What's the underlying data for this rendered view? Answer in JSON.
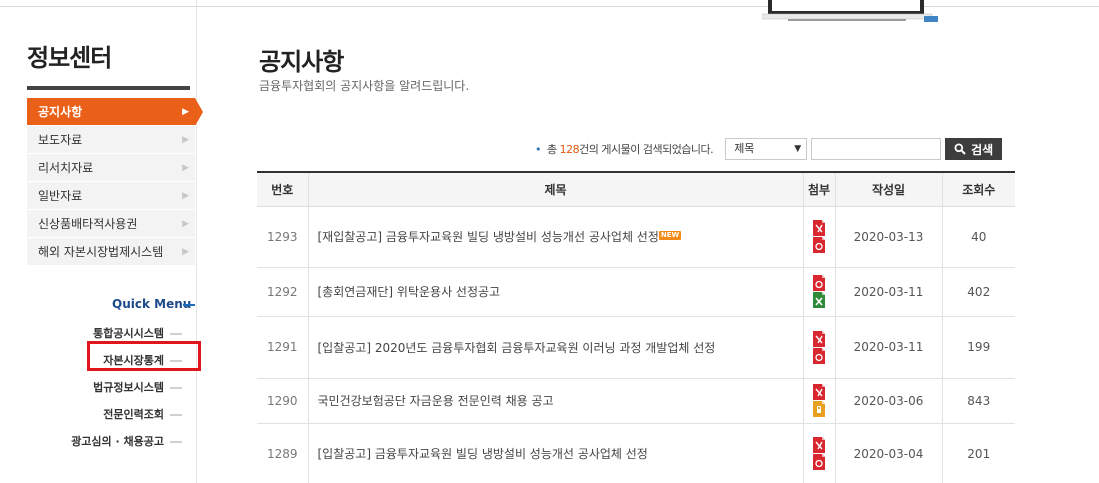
{
  "sidebar": {
    "title": "정보센터",
    "menu": [
      {
        "label": "공지사항",
        "active": true
      },
      {
        "label": "보도자료",
        "active": false
      },
      {
        "label": "리서치자료",
        "active": false
      },
      {
        "label": "일반자료",
        "active": false
      },
      {
        "label": "신상품배타적사용권",
        "active": false
      },
      {
        "label": "해외 자본시장법제시스템",
        "active": false
      }
    ],
    "quick_menu": {
      "title": "Quick Menu",
      "items": [
        "통합공시시스템",
        "자본시장통계",
        "법규정보시스템",
        "전문인력조회",
        "광고심의 · 채용공고"
      ],
      "highlighted": "자본시장통계"
    }
  },
  "main": {
    "title": "공지사항",
    "subtitle": "금융투자협회의 공지사항을 알려드립니다.",
    "search": {
      "count_prefix": "총",
      "count": "128",
      "count_suffix": "건의 게시물이 검색되었습니다.",
      "select_value": "제목",
      "input_value": "",
      "button_label": "검색"
    },
    "table": {
      "headers": [
        "번호",
        "제목",
        "첨부",
        "작성일",
        "조회수"
      ],
      "rows": [
        {
          "num": "1293",
          "title": "[재입찰공고] 금융투자교육원 빌딩 냉방설비 성능개선 공사업체 선정",
          "new": "NEW",
          "attachments": [
            "pdf-icon",
            "hwp-icon"
          ],
          "date": "2020-03-13",
          "views": "40"
        },
        {
          "num": "1292",
          "title": "[총회연금재단] 위탁운용사 선정공고",
          "new": "",
          "attachments": [
            "hwp-icon",
            "excel-icon"
          ],
          "date": "2020-03-11",
          "views": "402"
        },
        {
          "num": "1291",
          "title": "[입찰공고] 2020년도 금융투자협회 금융투자교육원 이러닝 과정 개발업체 선정",
          "new": "",
          "attachments": [
            "pdf-icon",
            "hwp-icon"
          ],
          "date": "2020-03-11",
          "views": "199"
        },
        {
          "num": "1290",
          "title": "국민건강보험공단 자금운용 전문인력 채용 공고",
          "new": "",
          "attachments": [
            "pdf-icon",
            "zip-icon"
          ],
          "date": "2020-03-06",
          "views": "843"
        },
        {
          "num": "1289",
          "title": "[입찰공고] 금융투자교육원 빌딩 냉방설비 성능개선 공사업체 선정",
          "new": "",
          "attachments": [
            "pdf-icon",
            "hwp-icon"
          ],
          "date": "2020-03-04",
          "views": "201"
        }
      ]
    }
  },
  "colors": {
    "accent": "#ea6018",
    "quick_menu": "#1d4a8b",
    "highlight_box": "#e0161e",
    "count": "#e25a12"
  }
}
